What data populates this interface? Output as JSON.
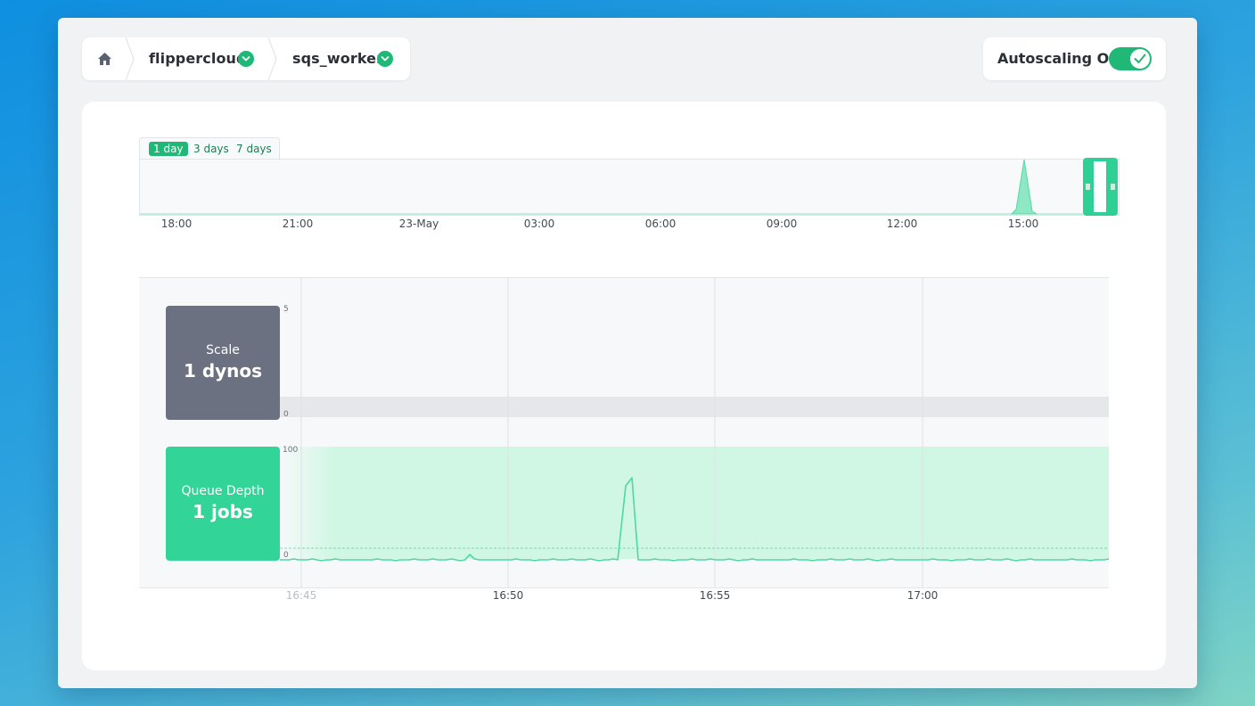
{
  "header": {
    "home_icon": "home-icon",
    "breadcrumbs": [
      {
        "label": "flippercloud",
        "icon": "chevron-down-circle-icon"
      },
      {
        "label": "sqs_worker",
        "icon": "chevron-down-circle-icon"
      }
    ],
    "autoscaling": {
      "label": "Autoscaling On",
      "enabled": true
    }
  },
  "colors": {
    "accent": "#1fb877",
    "scale_card": "#6b7180",
    "queue_card": "#33d498",
    "queue_line": "#4cd9a2",
    "queue_band": "#cff7e4"
  },
  "time_range": {
    "tabs": [
      "1 day",
      "3 days",
      "7 days"
    ],
    "selected": "1 day"
  },
  "metrics": {
    "scale": {
      "label": "Scale",
      "value": "1 dynos"
    },
    "queue": {
      "label": "Queue Depth",
      "value": "1 jobs"
    }
  },
  "chart_data": [
    {
      "type": "area",
      "name": "overview",
      "x_ticks": [
        "18:00",
        "21:00",
        "23-May",
        "03:00",
        "06:00",
        "09:00",
        "12:00",
        "15:00"
      ],
      "spike": {
        "at": "15:00",
        "relative_height": 1.0
      },
      "selection": "last ~20 minutes"
    },
    {
      "type": "line",
      "name": "scale",
      "y_ticks": [
        "5",
        "0"
      ],
      "ylim": [
        0,
        5
      ]
    },
    {
      "type": "line",
      "name": "queue",
      "y_ticks": [
        "100",
        "0"
      ],
      "ylim": [
        0,
        100
      ],
      "x_ticks": [
        "16:45",
        "16:50",
        "16:55",
        "17:00"
      ],
      "values": [
        1,
        1,
        1,
        1,
        1,
        1,
        1,
        1,
        1,
        1,
        1,
        1,
        1,
        1,
        1,
        1,
        1,
        1,
        1,
        1,
        1,
        1,
        1,
        1,
        1,
        1,
        1,
        1,
        1,
        1,
        1,
        1,
        1,
        1,
        1,
        1,
        1,
        1,
        1,
        1,
        1,
        1,
        1,
        1,
        1,
        1,
        1,
        1,
        1,
        1,
        1,
        1,
        1,
        1,
        1,
        1,
        1,
        1,
        1,
        1,
        1,
        1,
        1,
        1,
        1,
        1,
        1,
        1,
        1,
        1,
        1,
        1,
        1,
        1,
        1,
        1,
        1,
        1,
        1,
        1,
        1,
        1,
        1,
        1,
        1,
        1,
        1,
        1,
        1,
        1,
        1,
        1,
        1,
        1,
        1,
        1,
        1,
        1,
        1,
        1,
        1,
        1,
        1,
        1,
        1,
        1,
        1,
        1,
        1,
        1,
        1,
        1,
        1,
        1,
        1,
        1,
        1,
        1,
        1,
        1,
        1,
        1,
        1,
        1,
        1,
        1,
        1,
        1,
        1,
        1,
        1,
        1,
        1,
        1,
        1,
        1,
        1,
        1,
        1,
        1,
        1,
        1,
        1,
        1,
        1,
        1,
        1,
        1,
        1,
        1,
        1,
        1,
        1,
        1,
        1,
        1,
        1,
        1,
        1,
        1,
        1,
        1,
        1,
        1,
        1,
        1,
        1,
        1,
        1,
        1,
        1,
        1,
        1,
        1,
        1,
        1,
        1,
        1,
        1,
        1
      ],
      "threshold": 10
    }
  ]
}
